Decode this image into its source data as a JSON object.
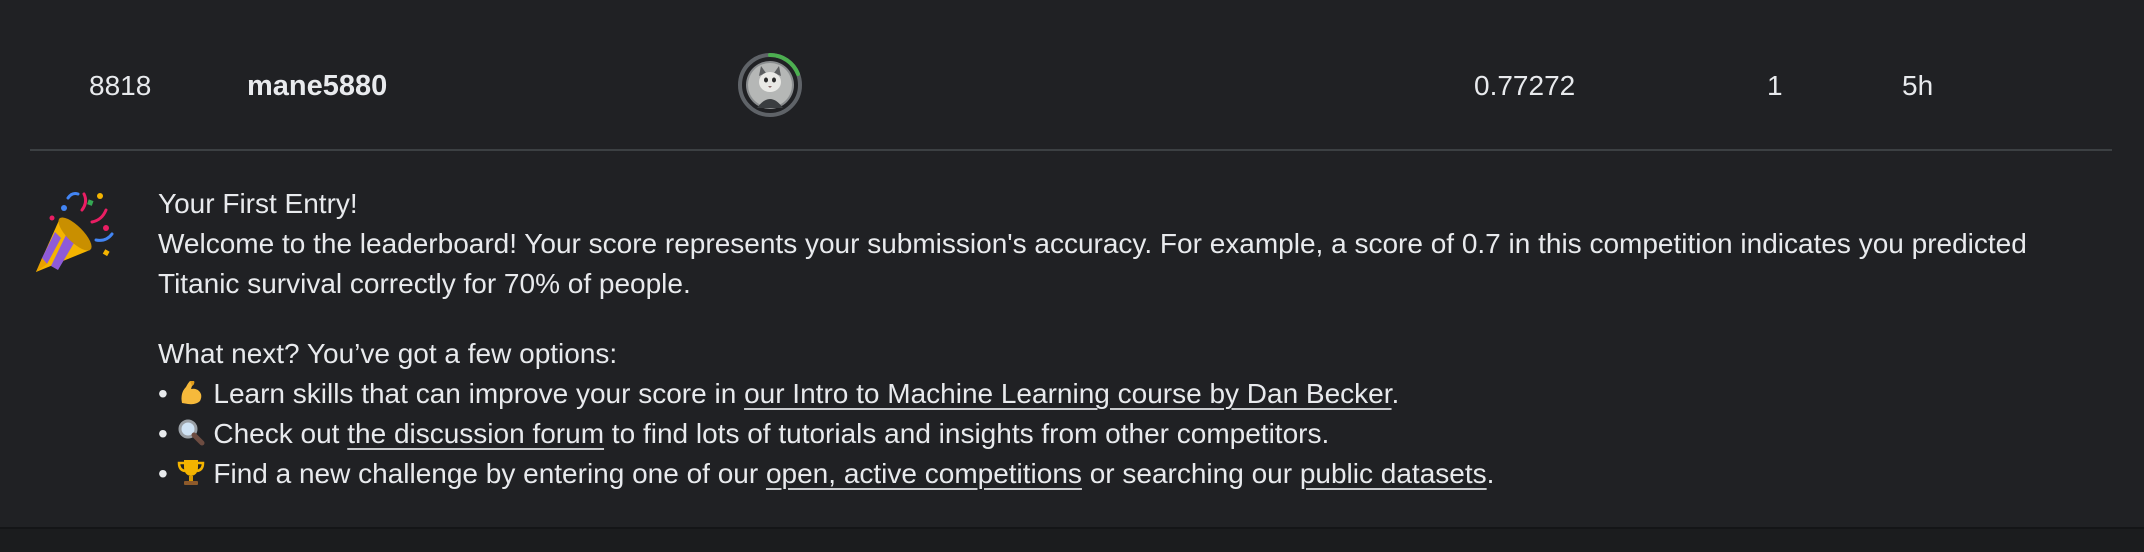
{
  "leaderboard_row": {
    "rank": "8818",
    "team_name": "mane5880",
    "score": "0.77272",
    "entries": "1",
    "last": "5h",
    "avatar_ring_color": "#4caf50"
  },
  "first_entry": {
    "title": "Your First Entry!",
    "welcome_text": "Welcome to the leaderboard! Your score represents your submission's accuracy. For example, a score of 0.7 in this competition indicates you predicted Titanic survival correctly for 70% of people.",
    "next_heading": "What next? You’ve got a few options:",
    "bullet1_prefix": "Learn skills that can improve your score in ",
    "bullet1_link": "our Intro to Machine Learning course by Dan Becker",
    "bullet1_suffix": ".",
    "bullet2_prefix": "Check out ",
    "bullet2_link": "the discussion forum",
    "bullet2_suffix": " to find lots of tutorials and insights from other competitors.",
    "bullet3_prefix": "Find a new challenge by entering one of our ",
    "bullet3_link1": "open, active competitions",
    "bullet3_middle": " or searching our ",
    "bullet3_link2": "public datasets",
    "bullet3_suffix": ".",
    "bullet_char": "•"
  },
  "icons": {
    "celebration": "party-popper-icon",
    "bullet1": "flexed-biceps-icon",
    "bullet2": "magnifying-glass-icon",
    "bullet3": "trophy-icon"
  }
}
